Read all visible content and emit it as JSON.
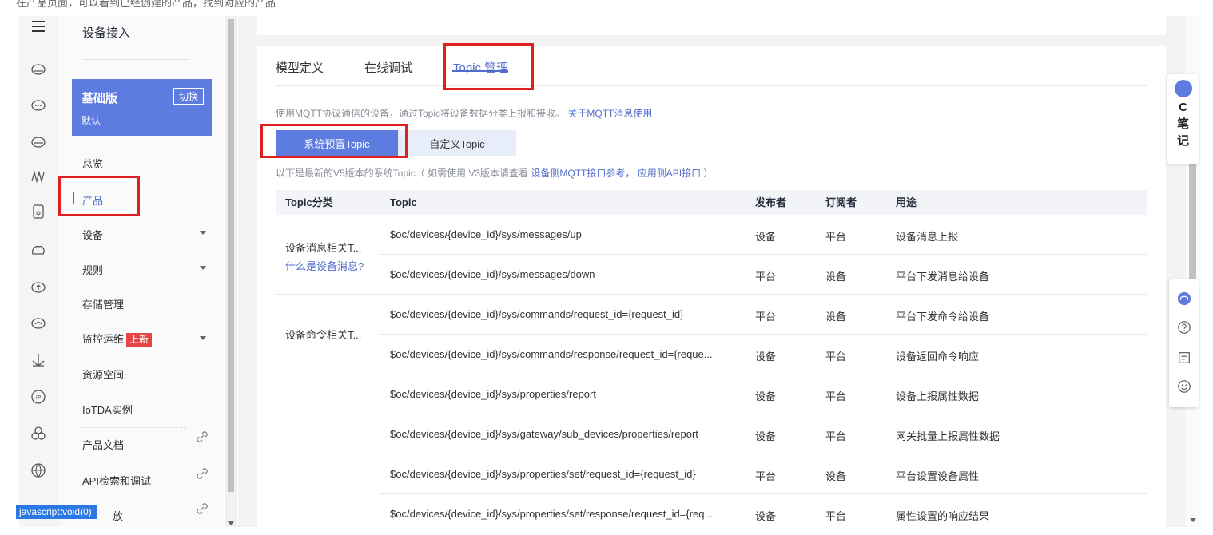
{
  "top_caption": "在产品页面，可以看到已经创建的产品，找到对应的产品",
  "rail_icons": [
    "menu-icon",
    "cloud-icon",
    "cloud-icon",
    "cloud-icon",
    "waves-icon",
    "device-icon",
    "cloud-icon",
    "cloud-icon",
    "cloud-icon",
    "anchor-icon",
    "ip-icon",
    "cluster-icon",
    "globe-icon"
  ],
  "nav": {
    "title": "设备接入",
    "version_name": "基础版",
    "version_sub": "默认",
    "switch_label": "切换",
    "items": {
      "overview": "总览",
      "product": "产品",
      "device": "设备",
      "rules": "规则",
      "storage": "存储管理",
      "monitor": "监控运维",
      "monitor_badge": "上新",
      "resource": "资源空间",
      "iotda": "IoTDA实例",
      "docs": "产品文档",
      "api": "API检索和调试",
      "partial": "放"
    },
    "status_tip": "javascript:void(0);"
  },
  "tabs": {
    "model": "模型定义",
    "debug": "在线调试",
    "topic": "Topic 管理"
  },
  "desc": {
    "text": "使用MQTT协议通信的设备，通过Topic将设备数据分类上报和接收。",
    "link": "关于MQTT消息使用"
  },
  "segments": {
    "system": "系统预置Topic",
    "custom": "自定义Topic"
  },
  "note": {
    "prefix": "以下是最新的V5版本的系统Topic（ 如需使用 V3版本请查看",
    "link1": "设备侧MQTT接口参考，",
    "link2": "应用侧API接口",
    "suffix": "）"
  },
  "table": {
    "headers": {
      "category": "Topic分类",
      "topic": "Topic",
      "publisher": "发布者",
      "subscriber": "订阅者",
      "usage": "用途"
    },
    "categories": {
      "messages": "设备消息相关T...",
      "messages_link": "什么是设备消息?",
      "commands": "设备命令相关T..."
    },
    "rows": [
      {
        "topic": "$oc/devices/{device_id}/sys/messages/up",
        "publisher": "设备",
        "subscriber": "平台",
        "usage": "设备消息上报"
      },
      {
        "topic": "$oc/devices/{device_id}/sys/messages/down",
        "publisher": "平台",
        "subscriber": "设备",
        "usage": "平台下发消息给设备"
      },
      {
        "topic": "$oc/devices/{device_id}/sys/commands/request_id={request_id}",
        "publisher": "平台",
        "subscriber": "设备",
        "usage": "平台下发命令给设备"
      },
      {
        "topic": "$oc/devices/{device_id}/sys/commands/response/request_id={reque...",
        "publisher": "设备",
        "subscriber": "平台",
        "usage": "设备返回命令响应"
      },
      {
        "topic": "$oc/devices/{device_id}/sys/properties/report",
        "publisher": "设备",
        "subscriber": "平台",
        "usage": "设备上报属性数据"
      },
      {
        "topic": "$oc/devices/{device_id}/sys/gateway/sub_devices/properties/report",
        "publisher": "设备",
        "subscriber": "平台",
        "usage": "网关批量上报属性数据"
      },
      {
        "topic": "$oc/devices/{device_id}/sys/properties/set/request_id={request_id}",
        "publisher": "平台",
        "subscriber": "设备",
        "usage": "平台设置设备属性"
      },
      {
        "topic": "$oc/devices/{device_id}/sys/properties/set/response/request_id={req...",
        "publisher": "设备",
        "subscriber": "平台",
        "usage": "属性设置的响应结果"
      }
    ]
  },
  "cnote": {
    "line1": "C",
    "line2": "笔",
    "line3": "记"
  },
  "colors": {
    "accent": "#5e7ce0",
    "link": "#526ecc",
    "highlight": "#e02020",
    "badge": "#e54545"
  }
}
